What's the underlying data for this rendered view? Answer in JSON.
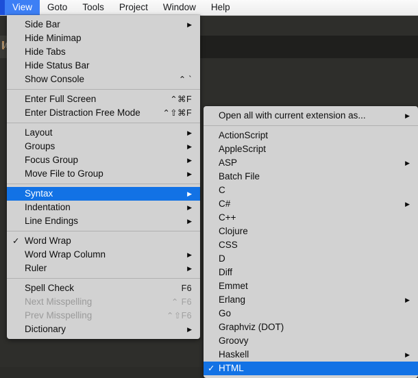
{
  "app": {
    "editor_tab_label": "M",
    "colors": {
      "menu_bg": "#d2d2d2",
      "highlight_blue": "#1272e5",
      "menubar_active_blue": "#3d7ff5",
      "editor_bg": "#2e2e2b",
      "disabled_text": "#9a9a9a"
    }
  },
  "menubar": {
    "items": [
      {
        "label": "View",
        "active": true
      },
      {
        "label": "Goto",
        "active": false
      },
      {
        "label": "Tools",
        "active": false
      },
      {
        "label": "Project",
        "active": false
      },
      {
        "label": "Window",
        "active": false
      },
      {
        "label": "Help",
        "active": false
      }
    ]
  },
  "view_menu": {
    "groups": [
      {
        "items": [
          {
            "label": "Side Bar",
            "arrow": "▶",
            "shortcut": "",
            "checked": false,
            "disabled": false,
            "selected": false
          },
          {
            "label": "Hide Minimap",
            "arrow": "",
            "shortcut": "",
            "checked": false,
            "disabled": false,
            "selected": false
          },
          {
            "label": "Hide Tabs",
            "arrow": "",
            "shortcut": "",
            "checked": false,
            "disabled": false,
            "selected": false
          },
          {
            "label": "Hide Status Bar",
            "arrow": "",
            "shortcut": "",
            "checked": false,
            "disabled": false,
            "selected": false
          },
          {
            "label": "Show Console",
            "arrow": "",
            "shortcut": "⌃ `",
            "checked": false,
            "disabled": false,
            "selected": false
          }
        ]
      },
      {
        "items": [
          {
            "label": "Enter Full Screen",
            "arrow": "",
            "shortcut": "⌃⌘F",
            "checked": false,
            "disabled": false,
            "selected": false
          },
          {
            "label": "Enter Distraction Free Mode",
            "arrow": "",
            "shortcut": "⌃⇧⌘F",
            "checked": false,
            "disabled": false,
            "selected": false
          }
        ]
      },
      {
        "items": [
          {
            "label": "Layout",
            "arrow": "▶",
            "shortcut": "",
            "checked": false,
            "disabled": false,
            "selected": false
          },
          {
            "label": "Groups",
            "arrow": "▶",
            "shortcut": "",
            "checked": false,
            "disabled": false,
            "selected": false
          },
          {
            "label": "Focus Group",
            "arrow": "▶",
            "shortcut": "",
            "checked": false,
            "disabled": false,
            "selected": false
          },
          {
            "label": "Move File to Group",
            "arrow": "▶",
            "shortcut": "",
            "checked": false,
            "disabled": false,
            "selected": false
          }
        ]
      },
      {
        "items": [
          {
            "label": "Syntax",
            "arrow": "▶",
            "shortcut": "",
            "checked": false,
            "disabled": false,
            "selected": true
          },
          {
            "label": "Indentation",
            "arrow": "▶",
            "shortcut": "",
            "checked": false,
            "disabled": false,
            "selected": false
          },
          {
            "label": "Line Endings",
            "arrow": "▶",
            "shortcut": "",
            "checked": false,
            "disabled": false,
            "selected": false
          }
        ]
      },
      {
        "items": [
          {
            "label": "Word Wrap",
            "arrow": "",
            "shortcut": "",
            "checked": true,
            "disabled": false,
            "selected": false
          },
          {
            "label": "Word Wrap Column",
            "arrow": "▶",
            "shortcut": "",
            "checked": false,
            "disabled": false,
            "selected": false
          },
          {
            "label": "Ruler",
            "arrow": "▶",
            "shortcut": "",
            "checked": false,
            "disabled": false,
            "selected": false
          }
        ]
      },
      {
        "items": [
          {
            "label": "Spell Check",
            "arrow": "",
            "shortcut": "F6",
            "checked": false,
            "disabled": false,
            "selected": false
          },
          {
            "label": "Next Misspelling",
            "arrow": "",
            "shortcut": "⌃ F6",
            "checked": false,
            "disabled": true,
            "selected": false
          },
          {
            "label": "Prev Misspelling",
            "arrow": "",
            "shortcut": "⌃⇧F6",
            "checked": false,
            "disabled": true,
            "selected": false
          },
          {
            "label": "Dictionary",
            "arrow": "▶",
            "shortcut": "",
            "checked": false,
            "disabled": false,
            "selected": false
          }
        ]
      }
    ]
  },
  "syntax_submenu": {
    "groups": [
      {
        "items": [
          {
            "label": "Open all with current extension as...",
            "arrow": "▶",
            "shortcut": "",
            "checked": false,
            "disabled": false,
            "selected": false
          }
        ]
      },
      {
        "items": [
          {
            "label": "ActionScript",
            "arrow": "",
            "shortcut": "",
            "checked": false,
            "disabled": false,
            "selected": false
          },
          {
            "label": "AppleScript",
            "arrow": "",
            "shortcut": "",
            "checked": false,
            "disabled": false,
            "selected": false
          },
          {
            "label": "ASP",
            "arrow": "▶",
            "shortcut": "",
            "checked": false,
            "disabled": false,
            "selected": false
          },
          {
            "label": "Batch File",
            "arrow": "",
            "shortcut": "",
            "checked": false,
            "disabled": false,
            "selected": false
          },
          {
            "label": "C",
            "arrow": "",
            "shortcut": "",
            "checked": false,
            "disabled": false,
            "selected": false
          },
          {
            "label": "C#",
            "arrow": "▶",
            "shortcut": "",
            "checked": false,
            "disabled": false,
            "selected": false
          },
          {
            "label": "C++",
            "arrow": "",
            "shortcut": "",
            "checked": false,
            "disabled": false,
            "selected": false
          },
          {
            "label": "Clojure",
            "arrow": "",
            "shortcut": "",
            "checked": false,
            "disabled": false,
            "selected": false
          },
          {
            "label": "CSS",
            "arrow": "",
            "shortcut": "",
            "checked": false,
            "disabled": false,
            "selected": false
          },
          {
            "label": "D",
            "arrow": "",
            "shortcut": "",
            "checked": false,
            "disabled": false,
            "selected": false
          },
          {
            "label": "Diff",
            "arrow": "",
            "shortcut": "",
            "checked": false,
            "disabled": false,
            "selected": false
          },
          {
            "label": "Emmet",
            "arrow": "",
            "shortcut": "",
            "checked": false,
            "disabled": false,
            "selected": false
          },
          {
            "label": "Erlang",
            "arrow": "▶",
            "shortcut": "",
            "checked": false,
            "disabled": false,
            "selected": false
          },
          {
            "label": "Go",
            "arrow": "",
            "shortcut": "",
            "checked": false,
            "disabled": false,
            "selected": false
          },
          {
            "label": "Graphviz (DOT)",
            "arrow": "",
            "shortcut": "",
            "checked": false,
            "disabled": false,
            "selected": false
          },
          {
            "label": "Groovy",
            "arrow": "",
            "shortcut": "",
            "checked": false,
            "disabled": false,
            "selected": false
          },
          {
            "label": "Haskell",
            "arrow": "▶",
            "shortcut": "",
            "checked": false,
            "disabled": false,
            "selected": false
          },
          {
            "label": "HTML",
            "arrow": "",
            "shortcut": "",
            "checked": true,
            "disabled": false,
            "selected": true
          }
        ]
      }
    ]
  }
}
